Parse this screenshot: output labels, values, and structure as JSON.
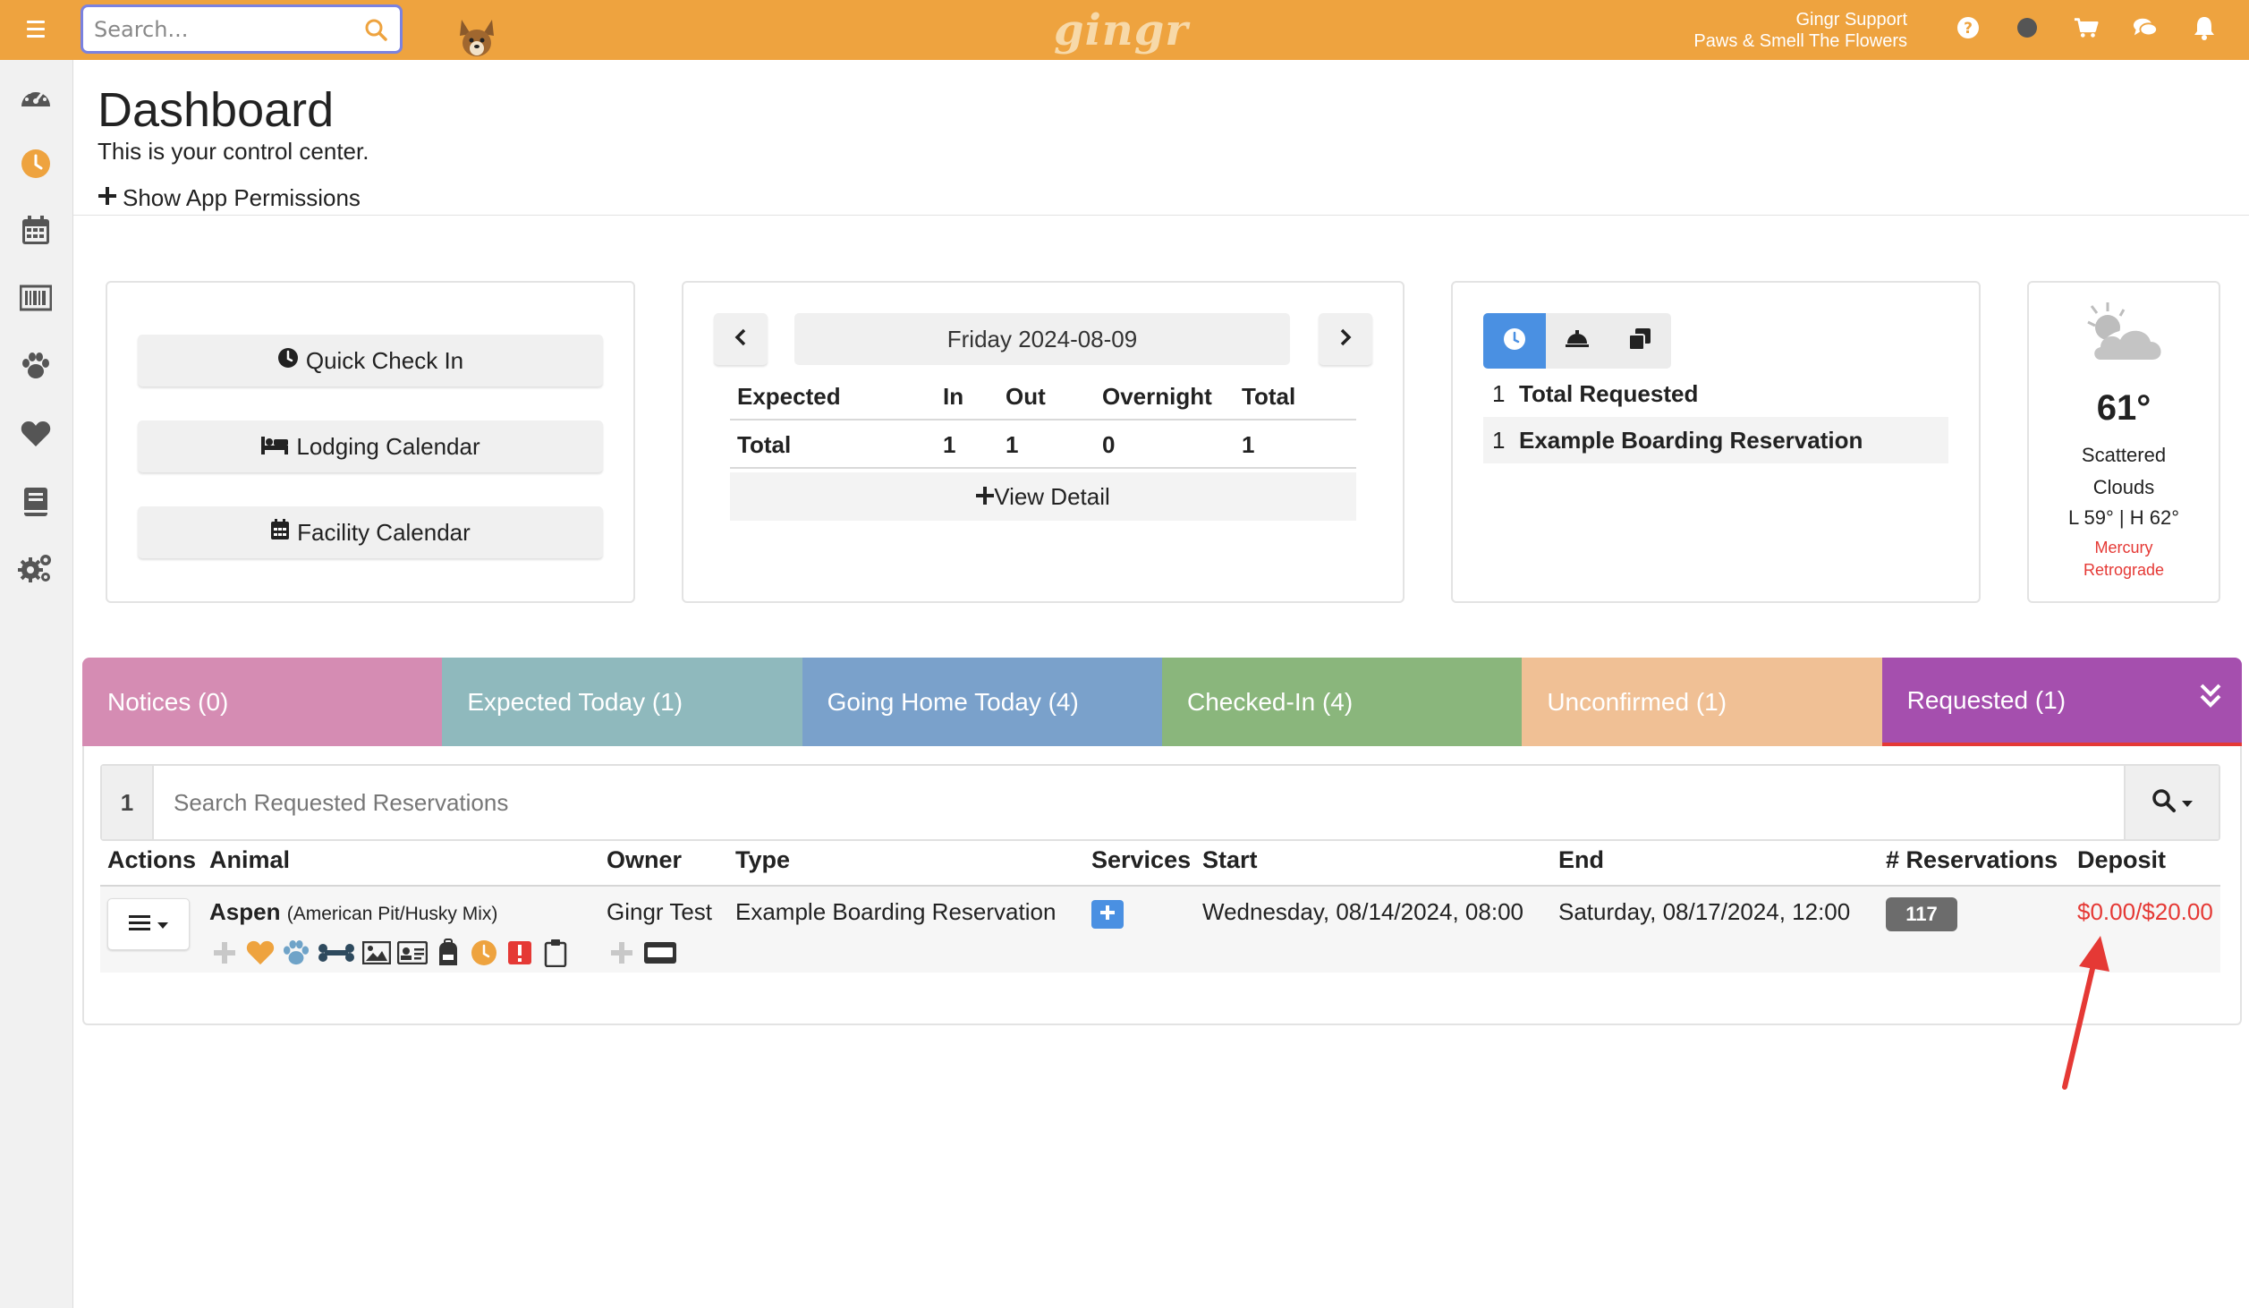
{
  "topbar": {
    "search_placeholder": "Search...",
    "logo": "gingr",
    "user_name": "Gingr Support",
    "business_name": "Paws & Smell The Flowers",
    "color": "#eea33f"
  },
  "sidebar": {
    "items": [
      "dashboard-icon",
      "clock-icon",
      "calendar-icon",
      "barcode-icon",
      "paw-icon",
      "heart-icon",
      "book-icon",
      "gears-icon"
    ]
  },
  "header": {
    "title": "Dashboard",
    "subtitle": "This is your control center.",
    "show_permissions": "Show App Permissions"
  },
  "quick_actions": {
    "check_in": "Quick Check In",
    "lodging": "Lodging Calendar",
    "facility": "Facility Calendar"
  },
  "daily_stats": {
    "date": "Friday 2024-08-09",
    "columns": [
      "Expected",
      "In",
      "Out",
      "Overnight",
      "Total"
    ],
    "row_label": "Total",
    "values": [
      "1",
      "1",
      "0",
      "1"
    ],
    "view_detail": "View Detail"
  },
  "requests": {
    "rows": [
      {
        "count": "1",
        "label": "Total Requested"
      },
      {
        "count": "1",
        "label": "Example Boarding Reservation"
      }
    ]
  },
  "weather": {
    "temp": "61°",
    "desc_line1": "Scattered",
    "desc_line2": "Clouds",
    "low_high": "L 59° | H 62°",
    "note_line1": "Mercury",
    "note_line2": "Retrograde"
  },
  "status_tabs": [
    {
      "label": "Notices (0)",
      "color": "#d58cb3"
    },
    {
      "label": "Expected Today (1)",
      "color": "#8fb9bd"
    },
    {
      "label": "Going Home Today (4)",
      "color": "#7aa1cb"
    },
    {
      "label": "Checked-In (4)",
      "color": "#8ab67c"
    },
    {
      "label": "Unconfirmed (1)",
      "color": "#f0c095"
    },
    {
      "label": "Requested (1)",
      "color": "#a54fae"
    }
  ],
  "table": {
    "count": "1",
    "search_placeholder": "Search Requested Reservations",
    "headers": {
      "actions": "Actions",
      "animal": "Animal",
      "owner": "Owner",
      "type": "Type",
      "services": "Services",
      "start": "Start",
      "end": "End",
      "reservations": "# Reservations",
      "deposit": "Deposit"
    },
    "row": {
      "animal_name": "Aspen",
      "breed": "(American Pit/Husky Mix)",
      "owner": "Gingr Test",
      "type": "Example Boarding Reservation",
      "start": "Wednesday, 08/14/2024, 08:00",
      "end": "Saturday, 08/17/2024, 12:00",
      "reservations": "117",
      "deposit": "$0.00/$20.00"
    }
  }
}
